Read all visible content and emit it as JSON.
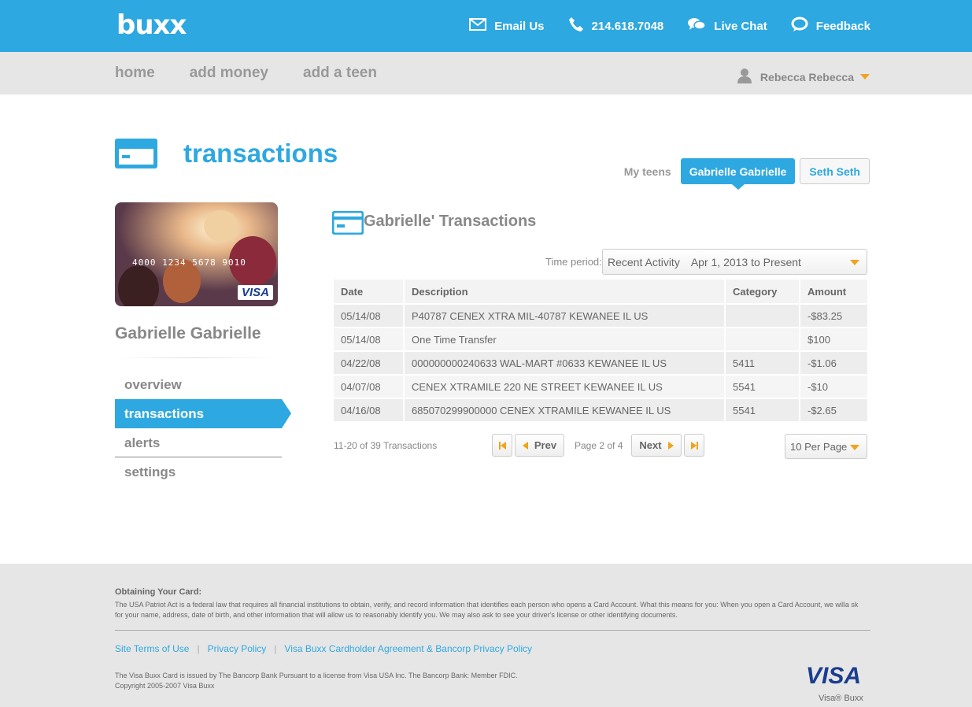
{
  "header": {
    "logo": "buxx",
    "links": {
      "email": "Email Us",
      "phone": "214.618.7048",
      "chat": "Live Chat",
      "feedback": "Feedback"
    }
  },
  "nav": {
    "home": "home",
    "add_money": "add money",
    "add_teen": "add a teen",
    "user": "Rebecca Rebecca"
  },
  "page": {
    "title": "transactions",
    "teens_label": "My teens",
    "teen_active": "Gabrielle Gabrielle",
    "teen_other": "Seth Seth"
  },
  "card": {
    "number": "4000 1234 5678 9010",
    "brand": "VISA"
  },
  "sidebar": {
    "teen_name": "Gabrielle Gabrielle",
    "items": [
      "overview",
      "transactions",
      "alerts",
      "settings"
    ]
  },
  "transactions": {
    "title": "Gabrielle' Transactions",
    "period_label": "Time period:",
    "period_option": "Recent Activity",
    "period_range": "Apr 1, 2013 to Present",
    "columns": [
      "Date",
      "Description",
      "Category",
      "Amount"
    ],
    "rows": [
      [
        "05/14/08",
        "P40787 CENEX XTRA MIL-40787 KEWANEE IL US",
        "",
        "-$83.25"
      ],
      [
        "05/14/08",
        "One Time Transfer",
        "",
        "$100"
      ],
      [
        "04/22/08",
        "000000000240633 WAL-MART #0633 KEWANEE IL US",
        "5411",
        "-$1.06"
      ],
      [
        "04/07/08",
        "CENEX XTRAMILE 220 NE STREET KEWANEE IL US",
        "5541",
        "-$10"
      ],
      [
        "04/16/08",
        "685070299900000 CENEX XTRAMILE KEWANEE IL US",
        "5541",
        "-$2.65"
      ]
    ],
    "pager": {
      "count": "11-20 of 39 Transactions",
      "prev": "Prev",
      "page_info": "Page 2 of 4",
      "next": "Next",
      "per_page": "10 Per Page"
    }
  },
  "footer": {
    "heading": "Obtaining Your Card:",
    "text": "The USA Patriot Act is a federal law that requires all financial institutions to obtain, verify, and record information that identifies each person who opens a Card Account. What this means for you: When you open a Card Account, we willa sk for your name, address, date of birth, and other information that will allow us to reasonably identify you. We may also ask to see your driver's license or other identifying documents.",
    "links": [
      "Site Terms of Use",
      "Privacy Policy",
      "Visa Buxx Cardholder Agreement & Bancorp Privacy Policy"
    ],
    "legal1": "The Visa Buxx Card is issued by The Bancorp Bank Pursuant to a license from Visa USA Inc. The Bancorp Bank: Member FDIC.",
    "legal2": "Copyright 2005-2007 Visa Buxx",
    "visa_logo": "VISA",
    "visa_sub": "Visa® Buxx"
  },
  "colors": {
    "brand_blue": "#2ea8e0",
    "accent_orange": "#f0a31c"
  }
}
